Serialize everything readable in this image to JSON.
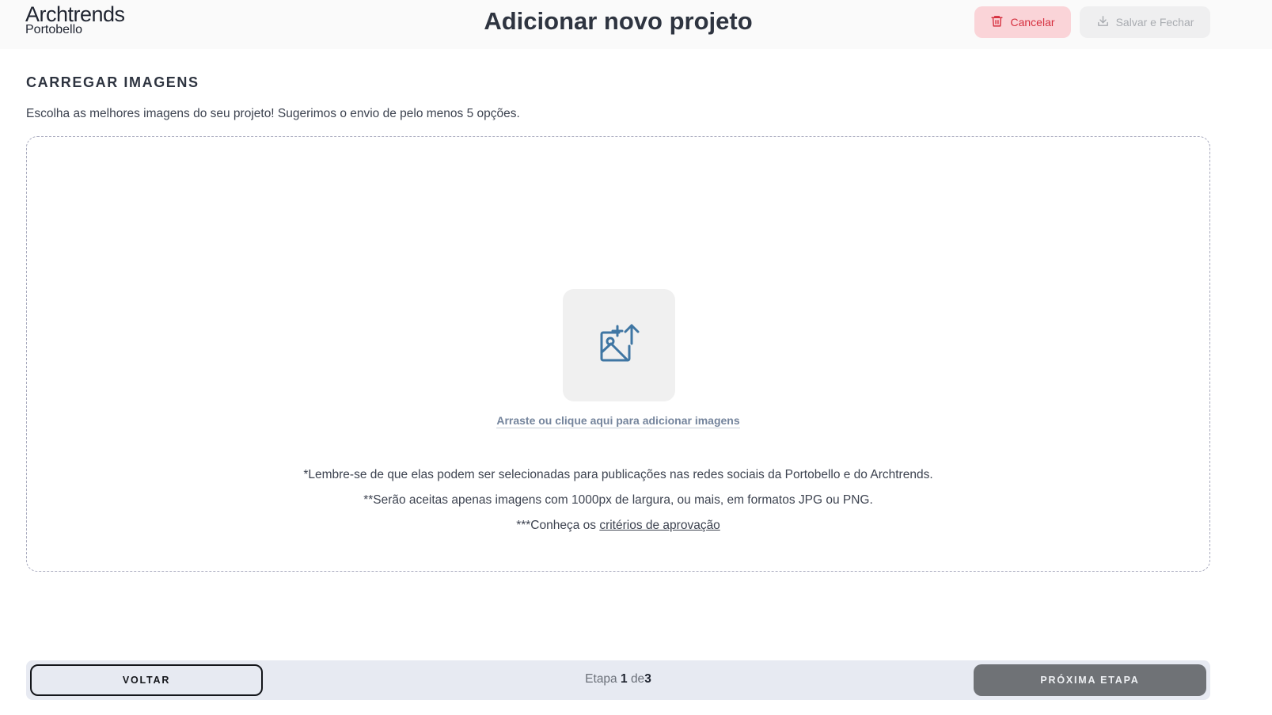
{
  "brand": {
    "name": "Archtrends",
    "sub": "Portobello"
  },
  "header": {
    "title": "Adicionar novo projeto",
    "cancel_label": "Cancelar",
    "save_label": "Salvar e Fechar",
    "cancel_icon": "trash-icon",
    "save_icon": "download-icon"
  },
  "section": {
    "title": "CARREGAR IMAGENS",
    "description": "Escolha as melhores imagens do seu projeto! Sugerimos o envio de pelo menos 5 opções."
  },
  "dropzone": {
    "icon": "image-upload-icon",
    "cta": "Arraste ou clique aqui para adicionar imagens",
    "note1": "*Lembre-se de que elas podem ser selecionadas para publicações nas redes sociais da Portobello e do Archtrends.",
    "note2": "**Serão aceitas apenas imagens com 1000px de largura, ou mais, em formatos JPG ou PNG.",
    "note3_prefix": "***Conheça os ",
    "note3_link": "critérios de aprovação"
  },
  "footer": {
    "back_label": "VOLTAR",
    "step_prefix": "Etapa",
    "step_current": "1",
    "step_sep": "de",
    "step_total": "3",
    "next_label": "PRÓXIMA ETAPA"
  },
  "colors": {
    "cancel_bg": "#fad4d8",
    "cancel_text": "#d6303f",
    "icon_blue": "#3f76a3",
    "next_bg": "#6f7276",
    "footer_bg": "#e7eaf2"
  }
}
